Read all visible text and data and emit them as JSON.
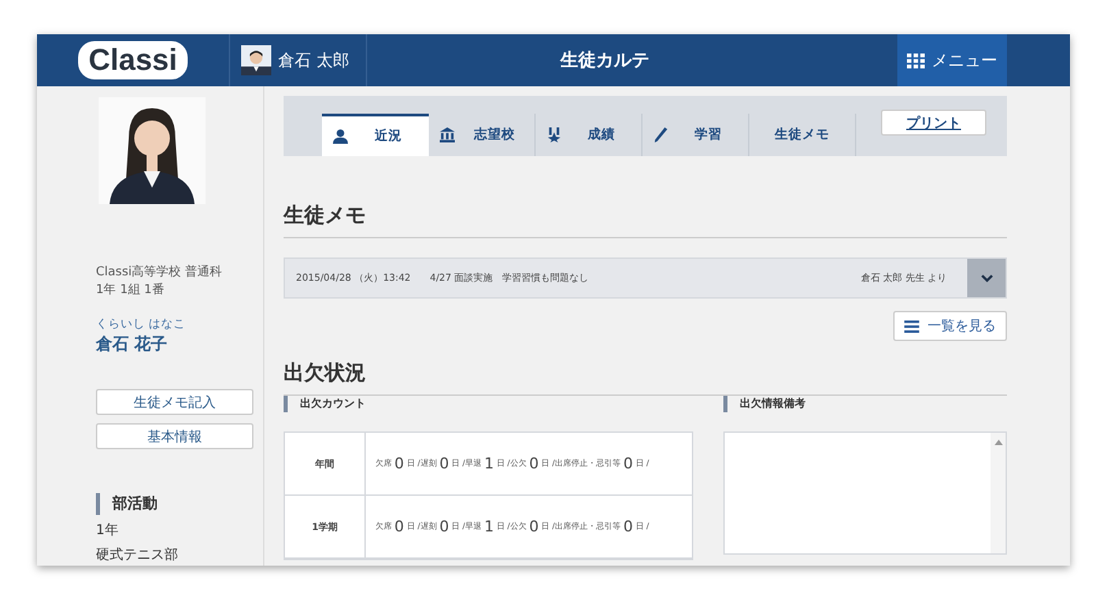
{
  "header": {
    "logo": "Classi",
    "user_name": "倉石 太郎",
    "title": "生徒カルテ",
    "menu_button": "メニュー"
  },
  "sidebar": {
    "school": "Classi高等学校 普通科",
    "class_info": "1年 1組 1番",
    "name_kana": "くらいし はなこ",
    "name": "倉石 花子",
    "buttons": [
      "生徒メモ記入",
      "基本情報"
    ],
    "club_heading": "部活動",
    "club_year": "1年",
    "club_name": "硬式テニス部"
  },
  "tabs": [
    {
      "label": "近況",
      "kind": "person",
      "selected": true
    },
    {
      "label": "志望校",
      "kind": "building",
      "selected": false
    },
    {
      "label": "成績",
      "kind": "medal",
      "selected": false
    },
    {
      "label": "学習",
      "kind": "pencil",
      "selected": false
    },
    {
      "label": "生徒メモ",
      "kind": "plain",
      "selected": false
    }
  ],
  "print_button": "プリント",
  "memo": {
    "heading": "生徒メモ",
    "date": "2015/04/28 （火）13:42",
    "text": "4/27 面談実施　学習習慣も問題なし",
    "author": "倉石 太郎 先生 より",
    "expanded": false,
    "list_button": "一覧を見る"
  },
  "attendance": {
    "heading": "出欠状況",
    "count_title": "出欠カウント",
    "notes_title": "出欠情報備考",
    "rows": [
      {
        "period": "年間",
        "items": [
          {
            "label": "欠席",
            "value": "0",
            "unit": "日 /"
          },
          {
            "label": "遅刻",
            "value": "0",
            "unit": "日 /"
          },
          {
            "label": "早退",
            "value": "1",
            "unit": "日 /"
          },
          {
            "label": "公欠",
            "value": "0",
            "unit": "日 /"
          },
          {
            "label": "出席停止・忌引等",
            "value": "0",
            "unit": "日 /"
          }
        ]
      },
      {
        "period": "1学期",
        "items": [
          {
            "label": "欠席",
            "value": "0",
            "unit": "日 /"
          },
          {
            "label": "遅刻",
            "value": "0",
            "unit": "日 /"
          },
          {
            "label": "早退",
            "value": "1",
            "unit": "日 /"
          },
          {
            "label": "公欠",
            "value": "0",
            "unit": "日 /"
          },
          {
            "label": "出席停止・忌引等",
            "value": "0",
            "unit": "日 /"
          }
        ]
      }
    ]
  }
}
